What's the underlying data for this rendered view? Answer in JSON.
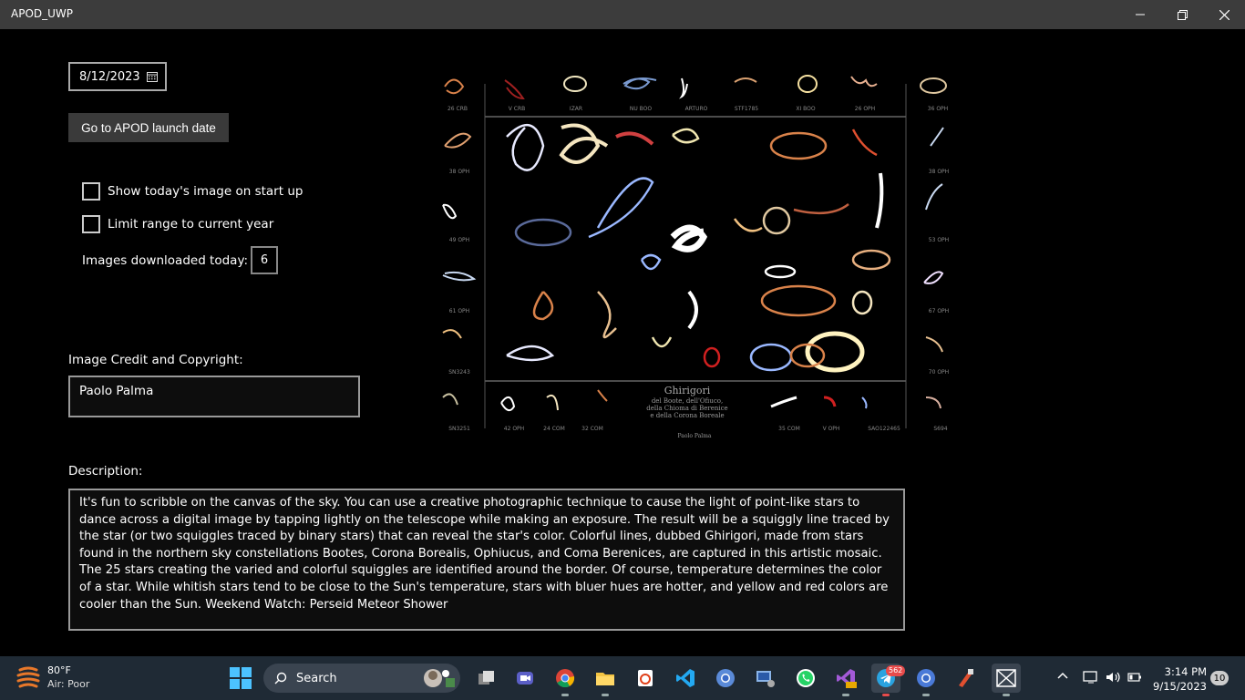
{
  "window": {
    "title": "APOD_UWP"
  },
  "controls": {
    "date": "8/12/2023",
    "launch_button": "Go to APOD launch date",
    "show_today_label": "Show today's image on start up",
    "show_today_checked": false,
    "limit_range_label": "Limit range to current year",
    "limit_range_checked": false,
    "downloads_label": "Images downloaded today:",
    "downloads_value": "6"
  },
  "credit": {
    "label": "Image Credit and Copyright:",
    "value": "Paolo Palma"
  },
  "description": {
    "label": "Description:",
    "text": "It's fun to scribble on the canvas of the sky. You can use a creative photographic technique to cause the light of point-like stars to dance across a digital image by tapping lightly on the telescope while making an exposure. The result will be a squiggly line traced by the star (or two squiggles traced by binary stars) that can reveal the star's color. Colorful lines, dubbed Ghirigori, made from stars found in the northern sky constellations Bootes, Corona Borealis, Ophiucus, and Coma Berenices, are captured in this artistic mosaic. The 25 stars creating the varied and colorful squiggles are identified around the border. Of course, temperature determines the color of a star. While whitish stars tend to be close to the Sun's temperature, stars with bluer hues are hotter, and yellow and red colors are cooler than the Sun.  Weekend Watch: Perseid Meteor Shower"
  },
  "image": {
    "title": "Ghirigori",
    "subtitle_1": "del Boote, dell'Ofiuco,",
    "subtitle_2": "della Chioma di Berenice",
    "subtitle_3": "e della Corona Boreale",
    "author": "Paolo Palma",
    "top_labels": [
      "26 CRB",
      "V CRB",
      "IZAR",
      "NU BOO",
      "ARTURO",
      "STF1785",
      "XI BOO",
      "26 OPH",
      "36 OPH"
    ],
    "left_labels": [
      "38 OPH",
      "49 OPH",
      "61 OPH",
      "SN3243"
    ],
    "right_labels": [
      "38 OPH",
      "53 OPH",
      "67 OPH",
      "70 OPH"
    ],
    "bottom_labels": [
      "SN3251",
      "42 OPH",
      "24 COM",
      "32 COM",
      "35 COM",
      "V OPH",
      "SAO122465",
      "S694"
    ]
  },
  "taskbar": {
    "weather_temp": "80°F",
    "weather_air": "Air: Poor",
    "search_label": "Search",
    "telegram_badge": "562",
    "time": "3:14 PM",
    "date": "9/15/2023",
    "notifications": "10"
  }
}
